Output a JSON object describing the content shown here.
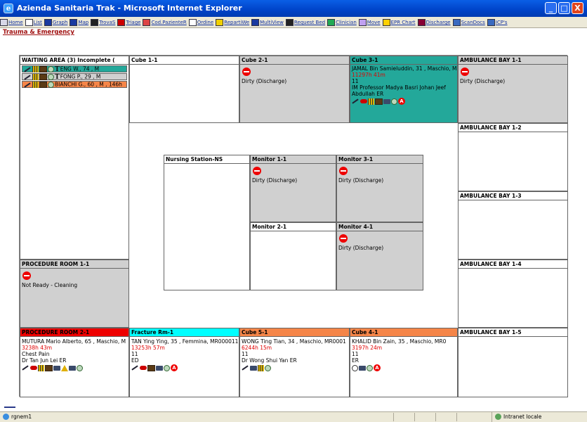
{
  "window": {
    "title": "Azienda Sanitaria Trak - Microsoft Internet Explorer",
    "buttons": [
      "_",
      "□",
      "X"
    ]
  },
  "toolbar": [
    {
      "label": "Home",
      "icon": "home-icon"
    },
    {
      "label": "List",
      "icon": "list-icon"
    },
    {
      "label": "Graph",
      "icon": "graph-icon"
    },
    {
      "label": "Map",
      "icon": "map-icon"
    },
    {
      "label": "TrovaS",
      "icon": "binoculars-icon"
    },
    {
      "label": "Triage",
      "icon": "triage-icon"
    },
    {
      "label": "Cod.PazienteR",
      "icon": "patient-code-icon"
    },
    {
      "label": "Ordine",
      "icon": "order-icon"
    },
    {
      "label": "RepartiWe",
      "icon": "ward-icon"
    },
    {
      "label": "MultiView",
      "icon": "multiview-icon"
    },
    {
      "label": "Request Bed",
      "icon": "bed-icon"
    },
    {
      "label": "Clinician",
      "icon": "clinician-icon"
    },
    {
      "label": "Move",
      "icon": "move-icon"
    },
    {
      "label": "EPR Chart",
      "icon": "chart-icon"
    },
    {
      "label": "Discharge",
      "icon": "discharge-icon"
    },
    {
      "label": "ScanDocs",
      "icon": "scan-icon"
    },
    {
      "label": "ICP's",
      "icon": "icp-icon"
    }
  ],
  "breadcrumb": "Trauma & Emergency",
  "colors": {
    "teal": "#23a89a",
    "red": "#ee0000",
    "cyan": "#00ffff",
    "orange": "#f58548"
  },
  "waiting": {
    "title": "WAITING AREA (3)  Incomplete (",
    "rows": [
      {
        "text": "ENG W., 74 , M",
        "color": "#23a89a"
      },
      {
        "text": "FONG P., 29 , M",
        "color": "#d0d0d0"
      },
      {
        "text": "BIANCHI G., 60 , M , 146h",
        "color": "#f58548"
      }
    ]
  },
  "cube11": {
    "title": "Cube 1-1"
  },
  "cube21": {
    "title": "Cube 2-1",
    "status": "Dirty (Discharge)"
  },
  "cube31": {
    "title": "Cube 3-1",
    "patient": "JAMAL Bin Samieluddin, 31 , Maschio, M",
    "time": "11297h 41m",
    "line3": "11",
    "doctor": "IM  Professor Madya Basri Johan Jeef",
    "doctor2": "Abdullah  ER"
  },
  "amb11": {
    "title": "AMBULANCE BAY 1-1",
    "status": "Dirty (Discharge)"
  },
  "amb12": {
    "title": "AMBULANCE BAY 1-2"
  },
  "amb13": {
    "title": "AMBULANCE BAY 1-3"
  },
  "amb14": {
    "title": "AMBULANCE BAY 1-4"
  },
  "amb15": {
    "title": "AMBULANCE BAY 1-5"
  },
  "nursing": {
    "title": "Nursing Station-NS"
  },
  "mon11": {
    "title": "Monitor 1-1",
    "status": "Dirty (Discharge)"
  },
  "mon31": {
    "title": "Monitor 3-1",
    "status": "Dirty (Discharge)"
  },
  "mon21": {
    "title": "Monitor 2-1"
  },
  "mon41": {
    "title": "Monitor 4-1",
    "status": "Dirty (Discharge)"
  },
  "proc11": {
    "title": "PROCEDURE ROOM 1-1",
    "status": "Not Ready - Cleaning"
  },
  "proc21": {
    "title": "PROCEDURE ROOM 2-1",
    "patient": "MUTURA Mario Alberto, 65 , Maschio, M",
    "time": "3238h 43m",
    "line3": "Chest Pain",
    "doctor": "Dr Tan Jun Lei  ER"
  },
  "frac": {
    "title": "Fracture Rm-1",
    "patient": "TAN Ying Ying, 35 , Femmina, MR000011",
    "time": "13253h 57m",
    "line3": "11",
    "line4": "ED"
  },
  "cube51": {
    "title": "Cube 5-1",
    "patient": "WONG Ting Tian, 34 , Maschio, MR0001",
    "time": "6244h 15m",
    "line3": "11",
    "doctor": "Dr Wong Shui Yan  ER"
  },
  "cube41": {
    "title": "Cube 4-1",
    "patient": "KHALID Bin Zain, 35 , Maschio, MR0",
    "time": "3197h 24m",
    "line3": "11",
    "line4": "ER"
  },
  "status": {
    "left": "rgnem1",
    "zone": "Intranet locale"
  }
}
